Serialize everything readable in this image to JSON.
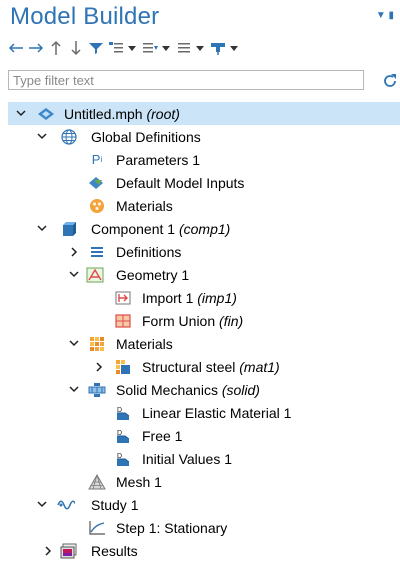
{
  "panel": {
    "title": "Model Builder"
  },
  "filter": {
    "placeholder": "Type filter text"
  },
  "tree": {
    "root": {
      "label": "Untitled.mph",
      "tag": "(root)"
    },
    "global_definitions": "Global Definitions",
    "parameters": "Parameters 1",
    "default_model_inputs": "Default Model Inputs",
    "global_materials": "Materials",
    "component": {
      "label": "Component 1",
      "tag": "(comp1)"
    },
    "definitions": "Definitions",
    "geometry": "Geometry 1",
    "import": {
      "label": "Import 1",
      "tag": "(imp1)"
    },
    "form_union": {
      "label": "Form Union",
      "tag": "(fin)"
    },
    "materials": "Materials",
    "structural_steel": {
      "label": "Structural steel",
      "tag": "(mat1)"
    },
    "solid_mechanics": {
      "label": "Solid Mechanics",
      "tag": "(solid)"
    },
    "linear_elastic": "Linear Elastic Material 1",
    "free": "Free 1",
    "initial_values": "Initial Values 1",
    "mesh": "Mesh 1",
    "study": "Study 1",
    "step": "Step 1: Stationary",
    "results": "Results"
  },
  "colors": {
    "title": "#2f74b5",
    "selected_row": "#cce4f7"
  }
}
